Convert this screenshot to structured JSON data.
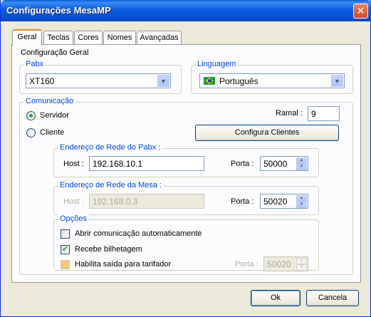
{
  "window": {
    "title": "Configurações MesaMP"
  },
  "tabs": [
    "Geral",
    "Teclas",
    "Cores",
    "Nomes",
    "Avançadas"
  ],
  "panel": {
    "heading": "Configuração Geral",
    "pabx": {
      "label": "Pabx",
      "value": "XT160"
    },
    "linguagem": {
      "label": "Linguagem",
      "value": "Português",
      "icon": "brazil-flag-icon"
    },
    "comunicacao": {
      "label": "Comunicação",
      "servidor": "Servidor",
      "cliente": "Cliente",
      "selected": "Servidor",
      "ramal_label": "Ramal :",
      "ramal_value": "9",
      "configura_button": "Configura Clientes",
      "rede_pabx": {
        "label": "Endereço de Rede do Pabx :",
        "host_label": "Host :",
        "host": "192.168.10.1",
        "porta_label": "Porta :",
        "porta": "50000"
      },
      "rede_mesa": {
        "label": "Endereço de Rede da Mesa :",
        "host_label": "Host :",
        "host": "192.168.0.3",
        "porta_label": "Porta :",
        "porta": "50020"
      },
      "opcoes": {
        "label": "Opções",
        "items": [
          {
            "label": "Abrir comunicação automaticamente",
            "checked": false
          },
          {
            "label": "Recebe bilhetagem",
            "checked": true
          },
          {
            "label": "Habilita saída para tarifador",
            "checked": false
          }
        ],
        "porta_label": "Porta :",
        "porta": "50020"
      }
    }
  },
  "buttons": {
    "ok": "Ok",
    "cancel": "Cancela"
  }
}
